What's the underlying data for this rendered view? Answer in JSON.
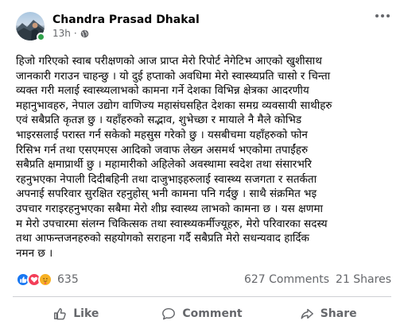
{
  "post": {
    "author": "Chandra Prasad Dhakal",
    "time": "13h",
    "separator": "·",
    "privacy_icon": "globe-icon",
    "body": "हिजो गरिएको स्वाब परीक्षणको आज प्राप्त मेरो रिपोर्ट नेगेटिभ आएको खुशीसाथ\nजानकारी गराउन चाहन्छु । यो दुई हप्ताको अवधिमा मेरो स्वास्थ्यप्रति चासो र चिन्ता\nव्यक्त गरी मलाई स्वास्थ्यलाभको कामना गर्ने देशका विभिन्न क्षेत्रका आदरणीय\nमहानुभावहरु, नेपाल उद्योग वाणिज्य महासंघसहित देशका समग्र व्यवसायी साथीहरु\nएवं सबैप्रति कृतज्ञ छु । यहाँहरुको सद्भाव, शुभेच्छा र मायाले नै मैले कोभिड\nभाइरसलाई परास्त गर्न सकेको महसुस गरेको छु । यसबीचमा यहाँहरुको फोन\nरिसिभ गर्न तथा एसएमएस आदिको जवाफ लेख्न असमर्थ भएकोमा तपाईंहरु\nसबैप्रति क्षमाप्रार्थी छु । महामारीको अहिलेको अवस्थामा स्वदेश तथा संसारभरि\nरहनुभएका नेपाली दिदीबहिनी तथा दाजुभाइहरुलाई स्वास्थ्य सजगता र सतर्कता\nअपनाई सपरिवार सुरक्षित रहनुहोस् भनी कामना पनि गर्दछु । साथै संक्रमित भइ\nउपचार गराइरहनुभएका सबैमा मेरो शीघ्र स्वास्थ्य लाभको कामना छ । यस क्षणमा\nम मेरो उपचारमा संलग्न चिकित्सक तथा स्वास्थ्यकर्मीज्यूहरु, मेरो परिवारका सदस्य\nतथा आफन्तजनहरुको सहयोगको सराहना गर्दै सबैप्रति मेरो सधन्यवाद हार्दिक\nनमन छ ।"
  },
  "stats": {
    "reactions": [
      "like-icon",
      "love-icon",
      "care-icon"
    ],
    "reaction_count": "635",
    "comments": "627 Comments",
    "shares": "21 Shares"
  },
  "actions": {
    "like": "Like",
    "comment": "Comment",
    "share": "Share"
  },
  "colors": {
    "like_blue": "#1877f2",
    "love_red": "#f33e58",
    "care_yellow": "#f7b125",
    "online_green": "#31a24c",
    "secondary_text": "#65676b"
  }
}
